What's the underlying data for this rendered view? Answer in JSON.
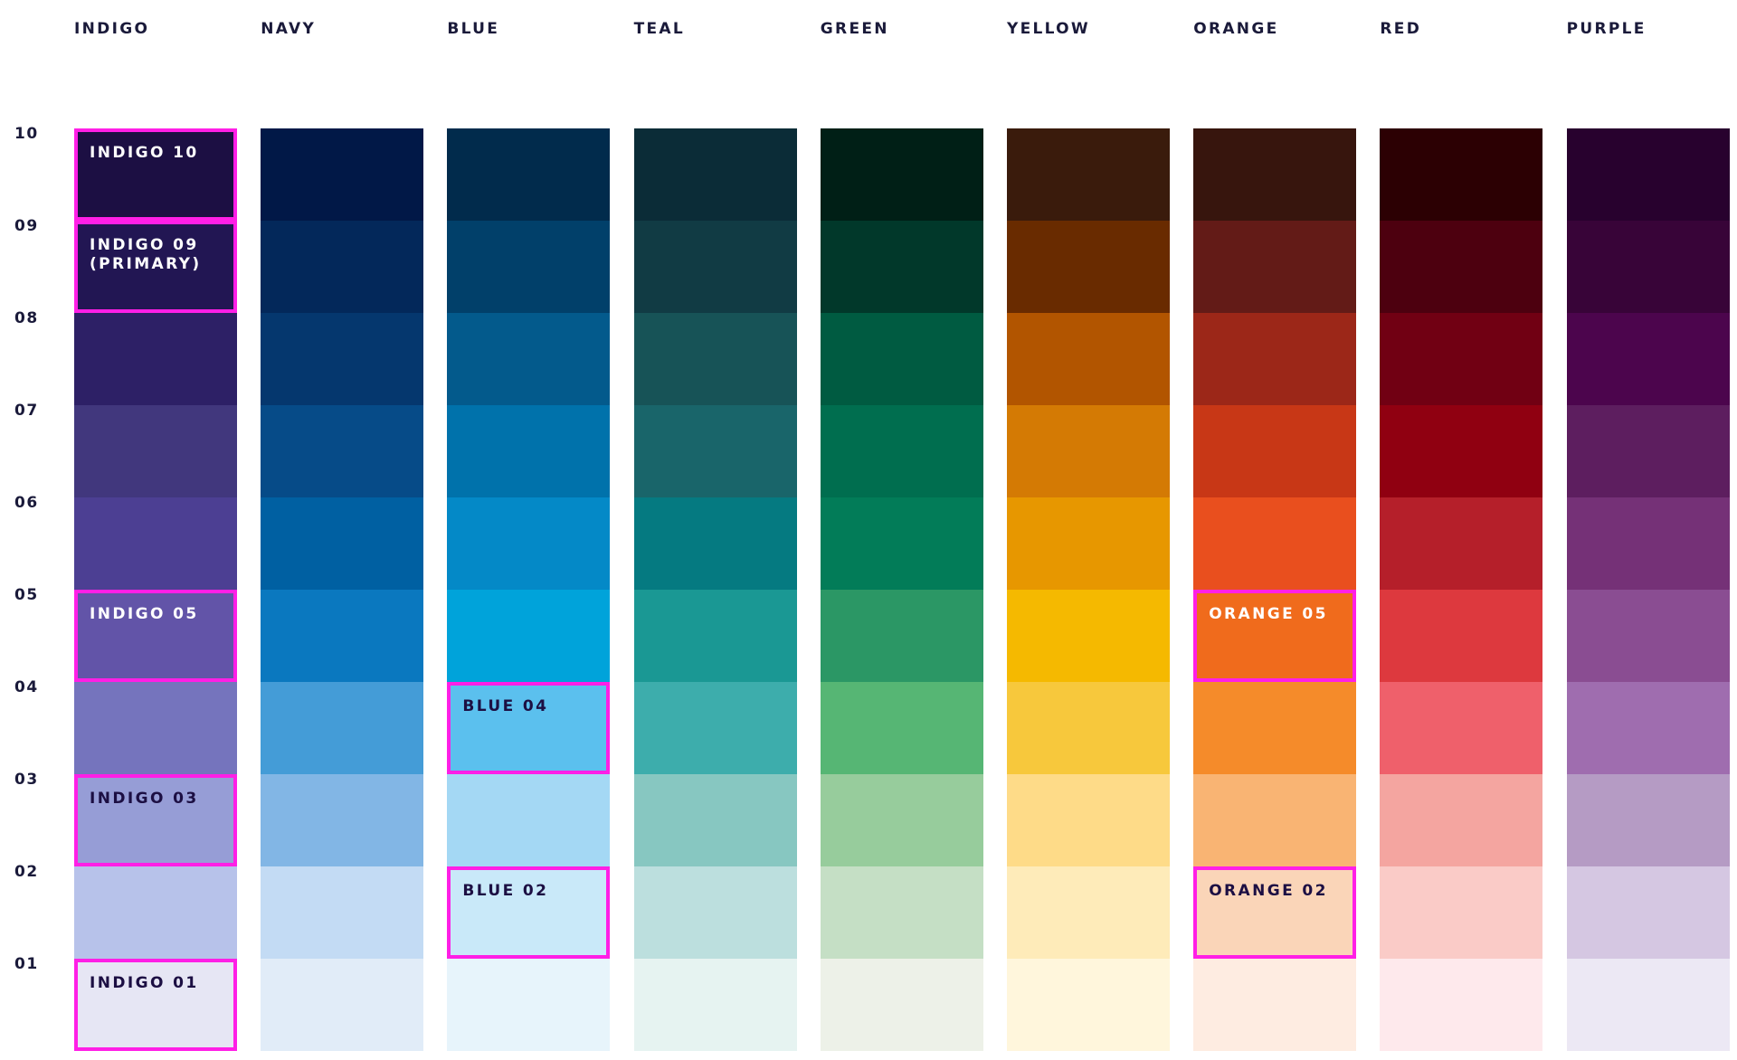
{
  "columns": [
    {
      "name": "INDIGO",
      "shades": [
        "#1c0f43",
        "#221653",
        "#2d2066",
        "#41377d",
        "#4c3f93",
        "#6254a8",
        "#7574bd",
        "#969dd6",
        "#b7c2ea",
        "#e6e6f4"
      ]
    },
    {
      "name": "NAVY",
      "shades": [
        "#011847",
        "#03285a",
        "#05376e",
        "#064b88",
        "#0060a2",
        "#0a78bf",
        "#449cd7",
        "#82b6e5",
        "#c3dbf4",
        "#e1ecf8"
      ]
    },
    {
      "name": "BLUE",
      "shades": [
        "#012b4c",
        "#01406a",
        "#035a8c",
        "#0072ab",
        "#0489c7",
        "#00a3da",
        "#5bc0ee",
        "#a4d8f4",
        "#c9e9f9",
        "#e7f4fb"
      ]
    },
    {
      "name": "TEAL",
      "shades": [
        "#0b2c37",
        "#113b44",
        "#175357",
        "#19656a",
        "#057a81",
        "#1a9894",
        "#3dadac",
        "#87c7c1",
        "#bcdfde",
        "#e6f3f1"
      ]
    },
    {
      "name": "GREEN",
      "shades": [
        "#001f16",
        "#01382a",
        "#005b41",
        "#006e4f",
        "#027c58",
        "#2b9765",
        "#56b674",
        "#97cc9c",
        "#c5dfc5",
        "#edf1e8"
      ]
    },
    {
      "name": "YELLOW",
      "shades": [
        "#3a1b0c",
        "#692b00",
        "#b25500",
        "#d47a04",
        "#e79700",
        "#f5b900",
        "#f7c83c",
        "#fedb88",
        "#feebb9",
        "#fff6dc"
      ]
    },
    {
      "name": "ORANGE",
      "shades": [
        "#37150d",
        "#631b17",
        "#9c2718",
        "#c83716",
        "#e94f1e",
        "#f06b1c",
        "#f58b2a",
        "#f9b473",
        "#fad5b8",
        "#feece1"
      ]
    },
    {
      "name": "RED",
      "shades": [
        "#2c0003",
        "#4d000f",
        "#710013",
        "#900011",
        "#b51f2a",
        "#dd393e",
        "#ef606b",
        "#f4a5a0",
        "#facbc7",
        "#fee9ec"
      ]
    },
    {
      "name": "PURPLE",
      "shades": [
        "#28012e",
        "#380438",
        "#4c054d",
        "#5d1e5f",
        "#753177",
        "#8a4d92",
        "#9f6daf",
        "#b59bc4",
        "#d5c7e2",
        "#ece8f4"
      ]
    }
  ],
  "rows": [
    "10",
    "09",
    "08",
    "07",
    "06",
    "05",
    "04",
    "03",
    "02",
    "01"
  ],
  "highlights": [
    {
      "column": 0,
      "row": 0,
      "label": "INDIGO 10",
      "text_color": "#ffffff"
    },
    {
      "column": 0,
      "row": 1,
      "label": "INDIGO 09\n(PRIMARY)",
      "text_color": "#ffffff"
    },
    {
      "column": 0,
      "row": 5,
      "label": "INDIGO 05",
      "text_color": "#ffffff"
    },
    {
      "column": 0,
      "row": 7,
      "label": "INDIGO 03",
      "text_color": "#1c0f43"
    },
    {
      "column": 0,
      "row": 9,
      "label": "INDIGO 01",
      "text_color": "#1c0f43"
    },
    {
      "column": 2,
      "row": 6,
      "label": "BLUE 04",
      "text_color": "#1c0f43"
    },
    {
      "column": 2,
      "row": 8,
      "label": "BLUE 02",
      "text_color": "#1c0f43"
    },
    {
      "column": 6,
      "row": 5,
      "label": "ORANGE 05",
      "text_color": "#ffffff"
    },
    {
      "column": 6,
      "row": 8,
      "label": "ORANGE 02",
      "text_color": "#1c0f43"
    }
  ],
  "highlight_border_color": "#ff1fe6"
}
